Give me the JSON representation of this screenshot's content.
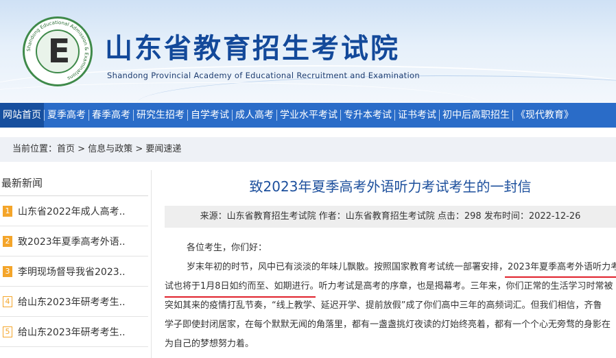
{
  "header": {
    "title": "山东省教育招生考试院",
    "subtitle": "Shandong Provincial Academy of Educational Recruitment and Examination",
    "logo_ring_text": "Shandong Educational Admission & Examinations",
    "logo_ring_text_cn": "山东省教育招生考试院",
    "logo_letter": "E",
    "logo_icon": "academy-seal-icon"
  },
  "nav": {
    "items": [
      {
        "label": "网站首页",
        "active": true
      },
      {
        "label": "夏季高考"
      },
      {
        "label": "春季高考"
      },
      {
        "label": "研究生招考"
      },
      {
        "label": "自学考试"
      },
      {
        "label": "成人高考"
      },
      {
        "label": "学业水平考试"
      },
      {
        "label": "专升本考试"
      },
      {
        "label": "证书考试"
      },
      {
        "label": "初中后高职招生"
      },
      {
        "label": "《现代教育》"
      }
    ]
  },
  "breadcrumb": {
    "prefix": "当前位置：",
    "items": [
      "首页",
      "信息与政策",
      "要闻速递"
    ],
    "separator": " > "
  },
  "sidebar": {
    "title": "最新新闻",
    "items": [
      {
        "num": "1",
        "text": "山东省2022年成人高考.."
      },
      {
        "num": "2",
        "text": "致2023年夏季高考外语.."
      },
      {
        "num": "3",
        "text": "李明现场督导我省2023.."
      },
      {
        "num": "4",
        "text": "给山东2023年研考考生.."
      },
      {
        "num": "5",
        "text": "给山东2023年研考考生.."
      }
    ]
  },
  "article": {
    "title": "致2023年夏季高考外语听力考试考生的一封信",
    "meta": "来源：山东省教育招生考试院 作者：山东省教育招生考试院 点击：298 发布时间：2022-12-26",
    "greeting": "各位考生，你们好：",
    "lines": [
      "岁末年初的时节，风中已有淡淡的年味儿飘散。按照国家教育考试统一部署安排，2023年夏季高考外语听力考",
      "试也将于1月8日如约而至、如期进行。听力考试是高考的序章，也是揭幕考。三年来，你们正常的生活学习时常被",
      "突如其来的疫情打乱节奏，“线上教学、延迟开学、提前放假”成了你们高中三年的高频词汇。但我们相信，齐鲁",
      "学子即使封闭居家，在每个默默无闻的角落里，都有一盏盏挑灯夜读的灯始终亮着，都有一个个心无旁骛的身影在",
      "为自己的梦想努力着。"
    ]
  },
  "colors": {
    "nav_bg": "#2a6cc8",
    "title_blue": "#13499a",
    "article_title": "#1c4f9c",
    "badge_orange": "#f4a52a",
    "highlight_red": "#e0202a"
  }
}
